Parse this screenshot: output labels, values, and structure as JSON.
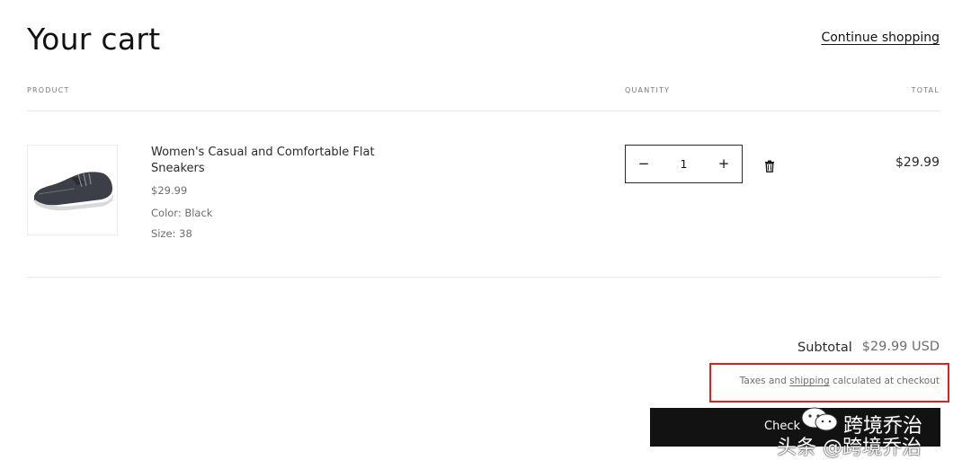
{
  "header": {
    "title": "Your cart",
    "continue_label": "Continue shopping"
  },
  "table": {
    "columns": [
      "PRODUCT",
      "QUANTITY",
      "TOTAL"
    ]
  },
  "item": {
    "title": "Women's Casual and Comfortable Flat Sneakers",
    "price": "$29.99",
    "color": "Color: Black",
    "size": "Size: 38",
    "quantity": "1",
    "line_total": "$29.99",
    "thumbnail_icon": "sneaker-image"
  },
  "qty": {
    "minus": "−",
    "plus": "+"
  },
  "summary": {
    "subtotal_label": "Subtotal",
    "subtotal_value": "$29.99 USD",
    "tax_prefix": "Taxes and ",
    "tax_link": "shipping",
    "tax_suffix": " calculated at checkout",
    "checkout_label": "Check"
  },
  "watermark": {
    "line1": "跨境乔治",
    "line2": "头条 @跨境乔治"
  },
  "colors": {
    "text": "#121212",
    "muted": "#6e6e6e",
    "highlight_border": "#e0201b",
    "button_bg": "#121212"
  }
}
